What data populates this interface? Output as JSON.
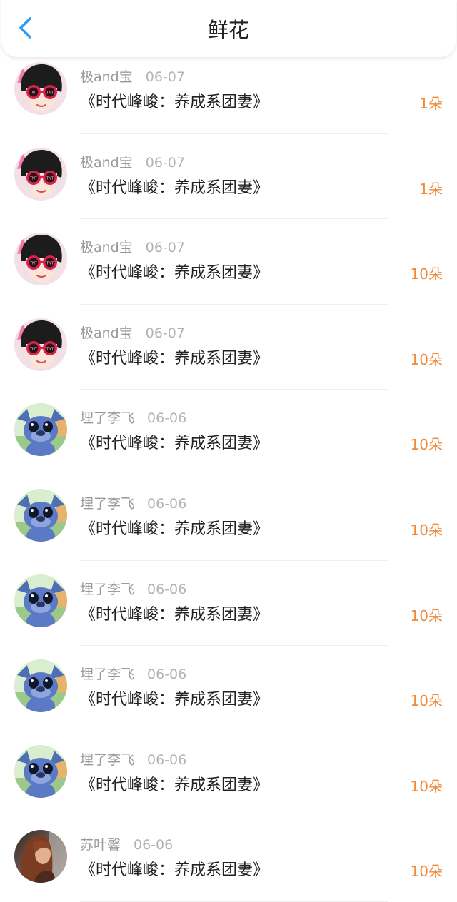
{
  "header": {
    "title": "鲜花",
    "back_icon": "chevron-left-icon"
  },
  "colors": {
    "accent_blue": "#2e9cf0",
    "flower_count": "#ee8a3a",
    "name_gray": "#9a9a9a",
    "title_text": "#222222"
  },
  "records": [
    {
      "user": "极and宝",
      "date": "06-07",
      "book": "《时代峰峻：养成系团妻》",
      "amount": "1朵",
      "avatar": "avatar-girl-tnt-glasses"
    },
    {
      "user": "极and宝",
      "date": "06-07",
      "book": "《时代峰峻：养成系团妻》",
      "amount": "1朵",
      "avatar": "avatar-girl-tnt-glasses"
    },
    {
      "user": "极and宝",
      "date": "06-07",
      "book": "《时代峰峻：养成系团妻》",
      "amount": "10朵",
      "avatar": "avatar-girl-tnt-glasses"
    },
    {
      "user": "极and宝",
      "date": "06-07",
      "book": "《时代峰峻：养成系团妻》",
      "amount": "10朵",
      "avatar": "avatar-girl-tnt-glasses"
    },
    {
      "user": "埋了李飞",
      "date": "06-06",
      "book": "《时代峰峻：养成系团妻》",
      "amount": "10朵",
      "avatar": "avatar-stitch-cartoon"
    },
    {
      "user": "埋了李飞",
      "date": "06-06",
      "book": "《时代峰峻：养成系团妻》",
      "amount": "10朵",
      "avatar": "avatar-stitch-cartoon"
    },
    {
      "user": "埋了李飞",
      "date": "06-06",
      "book": "《时代峰峻：养成系团妻》",
      "amount": "10朵",
      "avatar": "avatar-stitch-cartoon"
    },
    {
      "user": "埋了李飞",
      "date": "06-06",
      "book": "《时代峰峻：养成系团妻》",
      "amount": "10朵",
      "avatar": "avatar-stitch-cartoon"
    },
    {
      "user": "埋了李飞",
      "date": "06-06",
      "book": "《时代峰峻：养成系团妻》",
      "amount": "10朵",
      "avatar": "avatar-stitch-cartoon"
    },
    {
      "user": "苏叶馨",
      "date": "06-06",
      "book": "《时代峰峻：养成系团妻》",
      "amount": "10朵",
      "avatar": "avatar-photo-woman"
    }
  ]
}
